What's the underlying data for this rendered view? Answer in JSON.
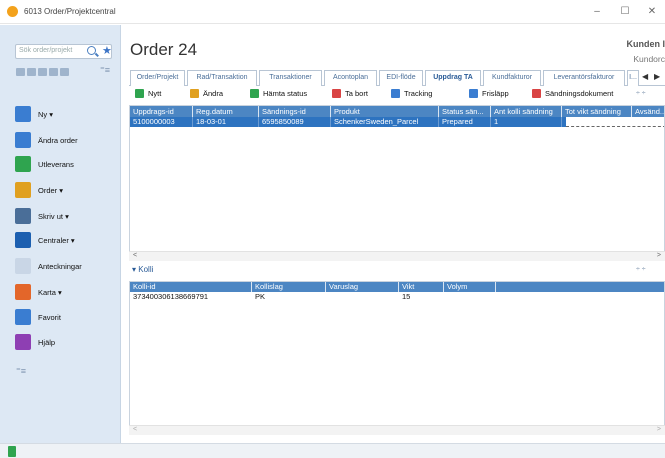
{
  "window": {
    "title": "6013 Order/Projektcentral",
    "minimize": "–",
    "maximize": "☐",
    "close": "✕"
  },
  "sidebar": {
    "search_placeholder": "Sök order/projekt",
    "items": [
      {
        "label": "Ny ▾",
        "icon": "new-document-icon",
        "color": "#3a7dd1"
      },
      {
        "label": "Ändra order",
        "icon": "edit-order-icon",
        "color": "#3a7dd1"
      },
      {
        "label": "Utleverans",
        "icon": "delivery-icon",
        "color": "#2fa44f"
      },
      {
        "label": "Order ▾",
        "icon": "order-icon",
        "color": "#e0a020"
      },
      {
        "label": "Skriv ut ▾",
        "icon": "printer-icon",
        "color": "#4a6e98"
      },
      {
        "label": "Centraler ▾",
        "icon": "central-icon",
        "color": "#1c5fb0"
      },
      {
        "label": "Anteckningar",
        "icon": "notes-icon",
        "color": "#c9d6e6"
      },
      {
        "label": "Karta ▾",
        "icon": "map-pin-icon",
        "color": "#e3662a"
      },
      {
        "label": "Favorit",
        "icon": "star-outline-icon",
        "color": "#3a7dd1"
      },
      {
        "label": "Hjälp",
        "icon": "help-icon",
        "color": "#8e3fb3"
      }
    ]
  },
  "main": {
    "title": "Order 24",
    "customer_label": "Kunden I",
    "customer_sub": "Kundorc",
    "tabs": [
      {
        "label": "Order/Projekt",
        "active": false
      },
      {
        "label": "Rad/Transaktion",
        "active": false
      },
      {
        "label": "Transaktioner",
        "active": false
      },
      {
        "label": "Acontoplan",
        "active": false
      },
      {
        "label": "EDI-flöde",
        "active": false
      },
      {
        "label": "Uppdrag TA",
        "active": true
      },
      {
        "label": "Kundfakturor",
        "active": false
      },
      {
        "label": "Leverantörsfakturor",
        "active": false
      },
      {
        "label": "I...",
        "active": false
      }
    ],
    "toolbar": [
      {
        "label": "Nytt",
        "icon": "new-icon",
        "color": "#2fa44f"
      },
      {
        "label": "Ändra",
        "icon": "edit-icon",
        "color": "#e0a020"
      },
      {
        "label": "Hämta status",
        "icon": "refresh-status-icon",
        "color": "#2fa44f"
      },
      {
        "label": "Ta bort",
        "icon": "delete-icon",
        "color": "#d94444"
      },
      {
        "label": "Tracking",
        "icon": "tracking-icon",
        "color": "#3a7dd1"
      },
      {
        "label": "Frisläpp",
        "icon": "release-icon",
        "color": "#3a7dd1"
      },
      {
        "label": "Sändningsdokument",
        "icon": "pdf-icon",
        "color": "#d94444"
      }
    ],
    "grid": {
      "columns": [
        "Uppdrags-id",
        "Reg.datum",
        "Sändnings-id",
        "Produkt",
        "Status sän...",
        "Ant kolli sändning",
        "Tot vikt sändning",
        "Avsänd..."
      ],
      "rows": [
        [
          "5100000003",
          "18-03-01",
          "6595850089",
          "SchenkerSweden_Parcel",
          "Prepared",
          "1",
          "",
          ""
        ]
      ]
    },
    "kolli": {
      "title": "Kolli",
      "columns": [
        "Kolli-id",
        "Kollislag",
        "Varuslag",
        "Vikt",
        "Volym"
      ],
      "rows": [
        [
          "373400306138669791",
          "PK",
          "",
          "15",
          ""
        ]
      ]
    }
  }
}
